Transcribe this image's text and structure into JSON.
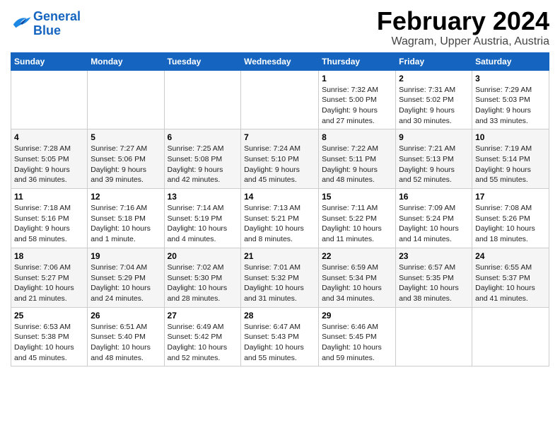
{
  "header": {
    "logo_line1": "General",
    "logo_line2": "Blue",
    "title": "February 2024",
    "subtitle": "Wagram, Upper Austria, Austria"
  },
  "weekdays": [
    "Sunday",
    "Monday",
    "Tuesday",
    "Wednesday",
    "Thursday",
    "Friday",
    "Saturday"
  ],
  "weeks": [
    [
      {
        "day": "",
        "info": ""
      },
      {
        "day": "",
        "info": ""
      },
      {
        "day": "",
        "info": ""
      },
      {
        "day": "",
        "info": ""
      },
      {
        "day": "1",
        "info": "Sunrise: 7:32 AM\nSunset: 5:00 PM\nDaylight: 9 hours\nand 27 minutes."
      },
      {
        "day": "2",
        "info": "Sunrise: 7:31 AM\nSunset: 5:02 PM\nDaylight: 9 hours\nand 30 minutes."
      },
      {
        "day": "3",
        "info": "Sunrise: 7:29 AM\nSunset: 5:03 PM\nDaylight: 9 hours\nand 33 minutes."
      }
    ],
    [
      {
        "day": "4",
        "info": "Sunrise: 7:28 AM\nSunset: 5:05 PM\nDaylight: 9 hours\nand 36 minutes."
      },
      {
        "day": "5",
        "info": "Sunrise: 7:27 AM\nSunset: 5:06 PM\nDaylight: 9 hours\nand 39 minutes."
      },
      {
        "day": "6",
        "info": "Sunrise: 7:25 AM\nSunset: 5:08 PM\nDaylight: 9 hours\nand 42 minutes."
      },
      {
        "day": "7",
        "info": "Sunrise: 7:24 AM\nSunset: 5:10 PM\nDaylight: 9 hours\nand 45 minutes."
      },
      {
        "day": "8",
        "info": "Sunrise: 7:22 AM\nSunset: 5:11 PM\nDaylight: 9 hours\nand 48 minutes."
      },
      {
        "day": "9",
        "info": "Sunrise: 7:21 AM\nSunset: 5:13 PM\nDaylight: 9 hours\nand 52 minutes."
      },
      {
        "day": "10",
        "info": "Sunrise: 7:19 AM\nSunset: 5:14 PM\nDaylight: 9 hours\nand 55 minutes."
      }
    ],
    [
      {
        "day": "11",
        "info": "Sunrise: 7:18 AM\nSunset: 5:16 PM\nDaylight: 9 hours\nand 58 minutes."
      },
      {
        "day": "12",
        "info": "Sunrise: 7:16 AM\nSunset: 5:18 PM\nDaylight: 10 hours\nand 1 minute."
      },
      {
        "day": "13",
        "info": "Sunrise: 7:14 AM\nSunset: 5:19 PM\nDaylight: 10 hours\nand 4 minutes."
      },
      {
        "day": "14",
        "info": "Sunrise: 7:13 AM\nSunset: 5:21 PM\nDaylight: 10 hours\nand 8 minutes."
      },
      {
        "day": "15",
        "info": "Sunrise: 7:11 AM\nSunset: 5:22 PM\nDaylight: 10 hours\nand 11 minutes."
      },
      {
        "day": "16",
        "info": "Sunrise: 7:09 AM\nSunset: 5:24 PM\nDaylight: 10 hours\nand 14 minutes."
      },
      {
        "day": "17",
        "info": "Sunrise: 7:08 AM\nSunset: 5:26 PM\nDaylight: 10 hours\nand 18 minutes."
      }
    ],
    [
      {
        "day": "18",
        "info": "Sunrise: 7:06 AM\nSunset: 5:27 PM\nDaylight: 10 hours\nand 21 minutes."
      },
      {
        "day": "19",
        "info": "Sunrise: 7:04 AM\nSunset: 5:29 PM\nDaylight: 10 hours\nand 24 minutes."
      },
      {
        "day": "20",
        "info": "Sunrise: 7:02 AM\nSunset: 5:30 PM\nDaylight: 10 hours\nand 28 minutes."
      },
      {
        "day": "21",
        "info": "Sunrise: 7:01 AM\nSunset: 5:32 PM\nDaylight: 10 hours\nand 31 minutes."
      },
      {
        "day": "22",
        "info": "Sunrise: 6:59 AM\nSunset: 5:34 PM\nDaylight: 10 hours\nand 34 minutes."
      },
      {
        "day": "23",
        "info": "Sunrise: 6:57 AM\nSunset: 5:35 PM\nDaylight: 10 hours\nand 38 minutes."
      },
      {
        "day": "24",
        "info": "Sunrise: 6:55 AM\nSunset: 5:37 PM\nDaylight: 10 hours\nand 41 minutes."
      }
    ],
    [
      {
        "day": "25",
        "info": "Sunrise: 6:53 AM\nSunset: 5:38 PM\nDaylight: 10 hours\nand 45 minutes."
      },
      {
        "day": "26",
        "info": "Sunrise: 6:51 AM\nSunset: 5:40 PM\nDaylight: 10 hours\nand 48 minutes."
      },
      {
        "day": "27",
        "info": "Sunrise: 6:49 AM\nSunset: 5:42 PM\nDaylight: 10 hours\nand 52 minutes."
      },
      {
        "day": "28",
        "info": "Sunrise: 6:47 AM\nSunset: 5:43 PM\nDaylight: 10 hours\nand 55 minutes."
      },
      {
        "day": "29",
        "info": "Sunrise: 6:46 AM\nSunset: 5:45 PM\nDaylight: 10 hours\nand 59 minutes."
      },
      {
        "day": "",
        "info": ""
      },
      {
        "day": "",
        "info": ""
      }
    ]
  ]
}
